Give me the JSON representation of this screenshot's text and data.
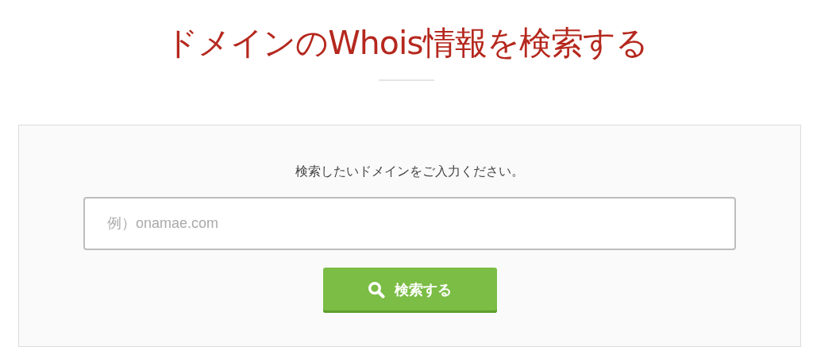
{
  "title": "ドメインのWhois情報を検索する",
  "search": {
    "prompt": "検索したいドメインをご入力ください。",
    "placeholder": "例）onamae.com",
    "button": "検索する"
  }
}
